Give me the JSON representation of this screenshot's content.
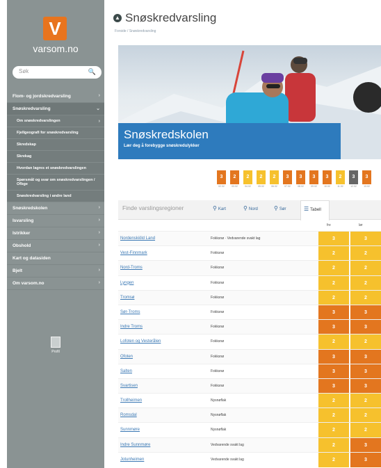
{
  "colors": {
    "level2": "#f6c12d",
    "level3": "#e3761f",
    "level_today": "#666666"
  },
  "sidebar": {
    "logo_letter": "V",
    "site_name": "varsom.no",
    "search_placeholder": "Søk",
    "items": [
      {
        "label": "Flom- og jordskredvarsling",
        "expanded": false
      },
      {
        "label": "Snøskredvarsling",
        "expanded": true,
        "active": true
      }
    ],
    "sub_items": [
      {
        "label": "Om snøskredvarslingen",
        "height": 17
      },
      {
        "label": "Fjellgeografi for snøskredvarsling",
        "height": 17
      },
      {
        "label": "Skredskap",
        "height": 17
      },
      {
        "label": "Skrekag",
        "height": 17
      },
      {
        "label": "Hvordan lagres et snøskredvarslingen",
        "height": 17
      },
      {
        "label": "Spørsmål og svar om snøskredvarslingen / Ofbge",
        "height": 23
      },
      {
        "label": "Snøskredvarsling i andre land",
        "height": 17
      }
    ],
    "more_items": [
      {
        "label": "Snøskredskolen",
        "chev": true
      },
      {
        "label": "Isvarsling",
        "chev": true
      },
      {
        "label": "Istrikker",
        "chev": true
      },
      {
        "label": "Obshold",
        "chev": true
      },
      {
        "label": "Kart og datasiden",
        "chev": false
      },
      {
        "label": "Bjelt",
        "chev": true
      },
      {
        "label": "Om varsom.no",
        "chev": true
      }
    ],
    "user_label": "Profil"
  },
  "header": {
    "title": "Snøskredvarsling",
    "breadcrumb": "Forside / Snøskredvarsling"
  },
  "hero": {
    "title": "Snøskredskolen",
    "subtitle": "Lær deg å forebygge snøskredulykker"
  },
  "timeline": [
    {
      "level": "3",
      "color": "#e3761f",
      "date": "02.02"
    },
    {
      "level": "2",
      "color": "#e3761f",
      "date": "03.02"
    },
    {
      "level": "2",
      "color": "#f6c12d",
      "date": "04.02"
    },
    {
      "level": "2",
      "color": "#f6c12d",
      "date": "05.02"
    },
    {
      "level": "2",
      "color": "#f6c12d",
      "date": "06.02"
    },
    {
      "level": "3",
      "color": "#e3761f",
      "date": "07.02"
    },
    {
      "level": "3",
      "color": "#e3761f",
      "date": "08.02"
    },
    {
      "level": "3",
      "color": "#e3761f",
      "date": "09.02"
    },
    {
      "level": "3",
      "color": "#e3761f",
      "date": "10.02"
    },
    {
      "level": "2",
      "color": "#f6c12d",
      "date": "11.02"
    },
    {
      "level": "3",
      "color": "#666666",
      "date": "12.02"
    },
    {
      "level": "3",
      "color": "#e3761f",
      "date": "13.02"
    }
  ],
  "tabs": {
    "search_placeholder": "Finde varslingsregioner",
    "items": [
      {
        "label": "Kart",
        "icon": "map-pin-icon",
        "active": false
      },
      {
        "label": "Nord",
        "icon": "map-pin-icon",
        "active": false
      },
      {
        "label": "Sør",
        "icon": "map-pin-icon",
        "active": false
      },
      {
        "label": "Tabell",
        "icon": "list-icon",
        "active": true
      }
    ]
  },
  "table": {
    "columns": [
      "",
      "",
      "fre",
      "lør"
    ],
    "rows": [
      {
        "region": "Nordenskiöld Land",
        "problem": "Fokksnø · Vedvarende svakt lag",
        "d1": "3",
        "c1": "#f6c12d",
        "d2": "3",
        "c2": "#f6c12d"
      },
      {
        "region": "Vest-Finnmark",
        "problem": "Fokksnø",
        "d1": "2",
        "c1": "#f6c12d",
        "d2": "2",
        "c2": "#f6c12d"
      },
      {
        "region": "Nord-Troms",
        "problem": "Fokksnø",
        "d1": "2",
        "c1": "#f6c12d",
        "d2": "2",
        "c2": "#f6c12d"
      },
      {
        "region": "Lyngen",
        "problem": "Fokksnø",
        "d1": "2",
        "c1": "#f6c12d",
        "d2": "2",
        "c2": "#f6c12d"
      },
      {
        "region": "Tromsø",
        "problem": "Fokksnø",
        "d1": "2",
        "c1": "#f6c12d",
        "d2": "2",
        "c2": "#f6c12d"
      },
      {
        "region": "Sør-Troms",
        "problem": "Fokksnø",
        "d1": "3",
        "c1": "#e3761f",
        "d2": "3",
        "c2": "#e3761f"
      },
      {
        "region": "Indre Troms",
        "problem": "Fokksnø",
        "d1": "3",
        "c1": "#e3761f",
        "d2": "3",
        "c2": "#e3761f"
      },
      {
        "region": "Lofoten og Vesterålen",
        "problem": "Fokksnø",
        "d1": "2",
        "c1": "#f6c12d",
        "d2": "2",
        "c2": "#f6c12d"
      },
      {
        "region": "Ofoten",
        "problem": "Fokksnø",
        "d1": "3",
        "c1": "#e3761f",
        "d2": "3",
        "c2": "#e3761f"
      },
      {
        "region": "Salten",
        "problem": "Fokksnø",
        "d1": "3",
        "c1": "#e3761f",
        "d2": "3",
        "c2": "#e3761f"
      },
      {
        "region": "Svartisen",
        "problem": "Fokksnø",
        "d1": "3",
        "c1": "#e3761f",
        "d2": "3",
        "c2": "#e3761f"
      },
      {
        "region": "Trollheimen",
        "problem": "Nysnøflak",
        "d1": "2",
        "c1": "#f6c12d",
        "d2": "2",
        "c2": "#f6c12d"
      },
      {
        "region": "Romsdal",
        "problem": "Nysnøflak",
        "d1": "2",
        "c1": "#f6c12d",
        "d2": "2",
        "c2": "#f6c12d"
      },
      {
        "region": "Sunnmøre",
        "problem": "Nysnøflak",
        "d1": "2",
        "c1": "#f6c12d",
        "d2": "2",
        "c2": "#f6c12d"
      },
      {
        "region": "Indre Sunnmøre",
        "problem": "Vedvarende svakt lag",
        "d1": "2",
        "c1": "#f6c12d",
        "d2": "3",
        "c2": "#e3761f"
      },
      {
        "region": "Jotunheimen",
        "problem": "Vedvarende svakt lag",
        "d1": "2",
        "c1": "#f6c12d",
        "d2": "3",
        "c2": "#e3761f"
      }
    ]
  }
}
